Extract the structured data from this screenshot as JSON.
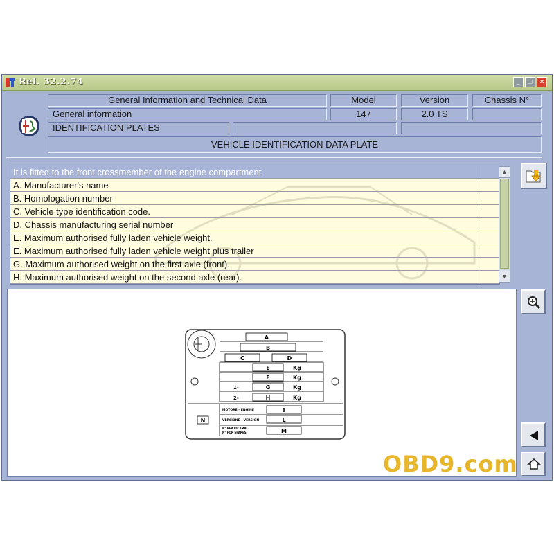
{
  "window": {
    "title": "Rel. 32.2.74"
  },
  "header": {
    "section_title": "General Information and Technical Data",
    "model_label": "Model",
    "version_label": "Version",
    "chassis_label": "Chassis N°",
    "subsection": "General information",
    "model_value": "147",
    "version_value": "2.0 TS",
    "topic": "IDENTIFICATION PLATES",
    "page_title": "VEHICLE IDENTIFICATION DATA PLATE"
  },
  "list": {
    "items": [
      "It is fitted to the front crossmember of the engine compartment",
      "A. Manufacturer's name",
      "B. Homologation number",
      "C. Vehicle type identification code.",
      "D. Chassis manufacturing serial number",
      "E. Maximum authorised fully laden vehicle weight.",
      "E. Maximum authorised fully laden vehicle weight plus trailer",
      "G. Maximum authorised weight on the first axle (front).",
      "H. Maximum authorised weight on the second axle (rear)."
    ],
    "selected_index": 0
  },
  "plate": {
    "letters": [
      "A",
      "B",
      "C",
      "D",
      "E",
      "F",
      "G",
      "H",
      "I",
      "L",
      "M",
      "N"
    ],
    "unit": "Kg",
    "axle1": "1-",
    "axle2": "2-",
    "motore": "MOTORE - ENGINE",
    "versione": "VERSIONE - VERSION",
    "ricambi1": "N° PER RICAMBI",
    "ricambi2": "N° FOR SPARES",
    "brand": "ALFA ROMEO"
  },
  "watermark": "OBD9.com",
  "colors": {
    "accent": "#a7b4d6",
    "selected": "#a8b4d8",
    "list_bg": "#fffce0",
    "close": "#d9402b"
  },
  "icons": {
    "app": "app-icon",
    "folder": "folder-arrow-icon",
    "zoom": "zoom-icon",
    "back": "back-arrow-icon",
    "home": "home-icon"
  }
}
